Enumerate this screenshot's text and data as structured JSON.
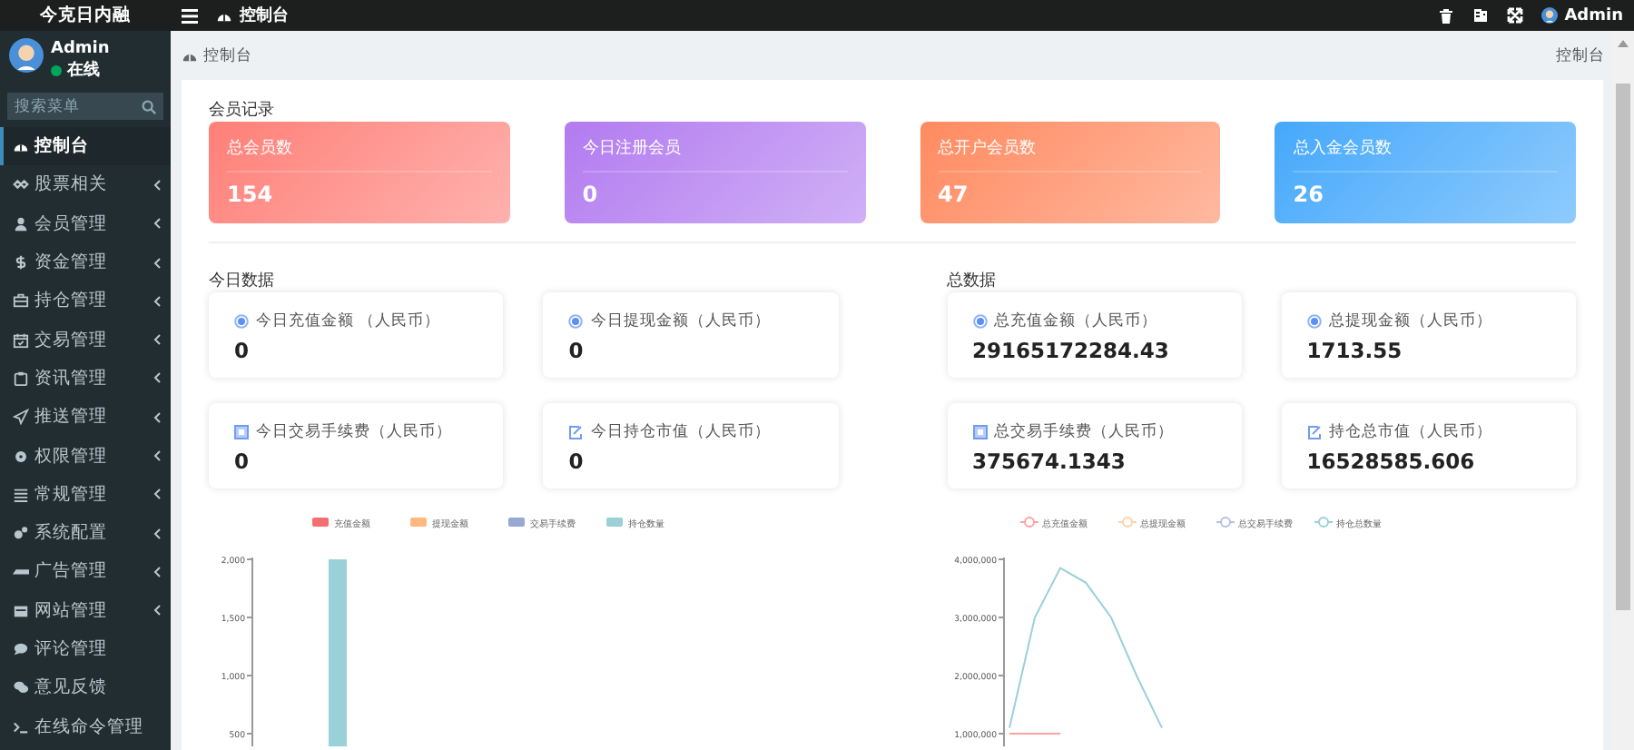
{
  "topbar": {
    "logo": "今克日内融",
    "title": "控制台",
    "user": "Admin"
  },
  "sidebar": {
    "user": {
      "name": "Admin",
      "status": "在线",
      "online": true
    },
    "search": {
      "placeholder": "搜索菜单"
    },
    "items": [
      {
        "label": "控制台",
        "selected": true,
        "has_children": false
      },
      {
        "label": "股票相关",
        "selected": false,
        "has_children": true
      },
      {
        "label": "会员管理",
        "selected": false,
        "has_children": true
      },
      {
        "label": "资金管理",
        "selected": false,
        "has_children": true
      },
      {
        "label": "持仓管理",
        "selected": false,
        "has_children": true
      },
      {
        "label": "交易管理",
        "selected": false,
        "has_children": true
      },
      {
        "label": "资讯管理",
        "selected": false,
        "has_children": true
      },
      {
        "label": "推送管理",
        "selected": false,
        "has_children": true
      },
      {
        "label": "权限管理",
        "selected": false,
        "has_children": true
      },
      {
        "label": "常规管理",
        "selected": false,
        "has_children": true
      },
      {
        "label": "系统配置",
        "selected": false,
        "has_children": true
      },
      {
        "label": "广告管理",
        "selected": false,
        "has_children": true
      },
      {
        "label": "网站管理",
        "selected": false,
        "has_children": true
      },
      {
        "label": "评论管理",
        "selected": false,
        "has_children": false
      },
      {
        "label": "意见反馈",
        "selected": false,
        "has_children": false
      },
      {
        "label": "在线命令管理",
        "selected": false,
        "has_children": false
      }
    ]
  },
  "breadcrumb": {
    "left": "控制台",
    "right": "控制台"
  },
  "members": {
    "title": "会员记录",
    "cards": [
      {
        "label": "总会员数",
        "value": "154",
        "color": "#ff7f78"
      },
      {
        "label": "今日注册会员",
        "value": "0",
        "color": "#b27bf0"
      },
      {
        "label": "总开户会员数",
        "value": "47",
        "color": "#ff8a60"
      },
      {
        "label": "总入金会员数",
        "value": "26",
        "color": "#45a8fb"
      }
    ]
  },
  "today": {
    "title": "今日数据",
    "cards": [
      {
        "kind": "radio",
        "label": "今日充值金额 （人民币）",
        "value": "0"
      },
      {
        "kind": "radio",
        "label": "今日提现金额（人民币）",
        "value": "0"
      },
      {
        "kind": "calendar",
        "label": "今日交易手续费（人民币）",
        "value": "0"
      },
      {
        "kind": "edit",
        "label": "今日持仓市值（人民币）",
        "value": "0"
      }
    ],
    "chart_data": {
      "type": "bar",
      "legend": "top",
      "series": [
        {
          "name": "充值金额",
          "color": "#f46f6f"
        },
        {
          "name": "提现金额",
          "color": "#ffb980"
        },
        {
          "name": "交易手续费",
          "color": "#97a7d6"
        },
        {
          "name": "持仓数量",
          "color": "#9ad0d8",
          "values": [
            2000
          ]
        }
      ],
      "ylim": [
        390.6,
        2000
      ],
      "yticks": [
        {
          "value": 500,
          "label": "500"
        },
        {
          "value": 1000,
          "label": "1,000"
        },
        {
          "value": 1500,
          "label": "1,500"
        },
        {
          "value": 2000,
          "label": "2,000"
        }
      ]
    }
  },
  "total": {
    "title": "总数据",
    "cards": [
      {
        "kind": "radio",
        "label": "总充值金额（人民币）",
        "value": "29165172284.43"
      },
      {
        "kind": "radio",
        "label": "总提现金额（人民币）",
        "value": "1713.55"
      },
      {
        "kind": "calendar",
        "label": "总交易手续费（人民币）",
        "value": "375674.1343"
      },
      {
        "kind": "edit",
        "label": "持仓总市值（人民币）",
        "value": "16528585.606"
      }
    ],
    "chart_data": {
      "type": "line",
      "legend": "top",
      "series": [
        {
          "name": "总充值金额",
          "color": "#f9a3a0",
          "values": [
            1000000,
            1000000,
            1000000,
            null,
            null,
            null,
            null
          ]
        },
        {
          "name": "总提现金额",
          "color": "#ffd2a8"
        },
        {
          "name": "总交易手续费",
          "color": "#b7c2e3"
        },
        {
          "name": "持仓总数量",
          "color": "#9ad0d8",
          "values": [
            1100000,
            3000000,
            3850000,
            3600000,
            3000000,
            2000000,
            1100000
          ]
        }
      ],
      "ylim": [
        781250,
        4000000
      ],
      "yticks": [
        {
          "value": 1000000,
          "label": "1,000,000"
        },
        {
          "value": 2000000,
          "label": "2,000,000"
        },
        {
          "value": 3000000,
          "label": "3,000,000"
        },
        {
          "value": 4000000,
          "label": "4,000,000"
        }
      ]
    }
  }
}
